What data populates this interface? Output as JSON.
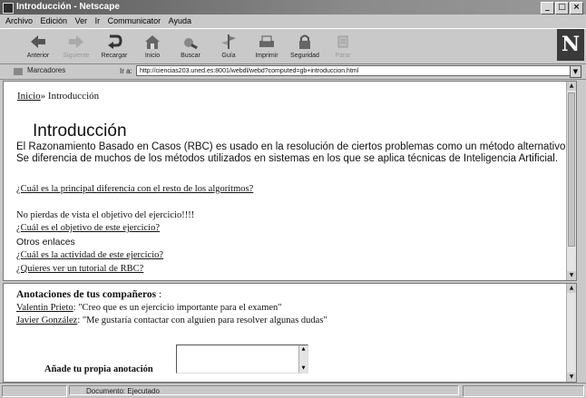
{
  "window": {
    "title": "Introducción - Netscape",
    "controls": [
      "_",
      "□",
      "×"
    ]
  },
  "menu": [
    "Archivo",
    "Edición",
    "Ver",
    "Ir",
    "Communicator",
    "Ayuda"
  ],
  "toolbar": {
    "buttons": [
      {
        "label": "Anterior",
        "icon": "back-arrow-icon"
      },
      {
        "label": "Siguiente",
        "icon": "forward-arrow-icon"
      },
      {
        "label": "Recargar",
        "icon": "reload-icon"
      },
      {
        "label": "Inicio",
        "icon": "home-icon"
      },
      {
        "label": "Buscar",
        "icon": "search-icon"
      },
      {
        "label": "Guía",
        "icon": "guide-icon"
      },
      {
        "label": "Imprimir",
        "icon": "print-icon"
      },
      {
        "label": "Seguridad",
        "icon": "security-icon"
      },
      {
        "label": "Parar",
        "icon": "stop-icon"
      }
    ],
    "brand": "N"
  },
  "location": {
    "bookmarks": "Marcadores",
    "label": "Ir a:",
    "url": "http://ciencias203.uned.es:8001/webdl/webd?computed=gb+introduccion.html"
  },
  "content": {
    "breadcrumb_link": "Inicio",
    "breadcrumb_sep": "»",
    "breadcrumb_current": "Introducción",
    "heading": "Introducción",
    "paragraph": "El Razonamiento Basado en Casos (RBC) es usado en la resolución de ciertos problemas como un método alternativo. Se diferencia de muchos de los métodos utilizados en sistemas en los que se aplica técnicas de Inteligencia Artificial.",
    "link_difference": "¿Cuál es la principal diferencia con el resto de los algoritmos?",
    "reminder": "No pierdas de vista el objetivo del ejercicio!!!!",
    "link_objective": "¿Cuál es el objetivo de este ejercicio?",
    "other_links_label": "Otros enlaces",
    "link_activity": "¿Cuál es la actividad de este ejercicio?",
    "link_tutorial": "¿Quieres ver un tutorial de RBC?"
  },
  "annotations": {
    "title": "Anotaciones de tus compañeros",
    "title_colon": ":",
    "items": [
      {
        "author": "Valentin Prieto",
        "text": ": \"Creo que es un ejercicio importante para el examen\""
      },
      {
        "author": "Javier González",
        "text": ": \"Me gustaría contactar con alguien para resolver algunas dudas\""
      }
    ],
    "add_label": "Añade tu propia anotación"
  },
  "status": {
    "text": "Documento: Ejecutado"
  }
}
